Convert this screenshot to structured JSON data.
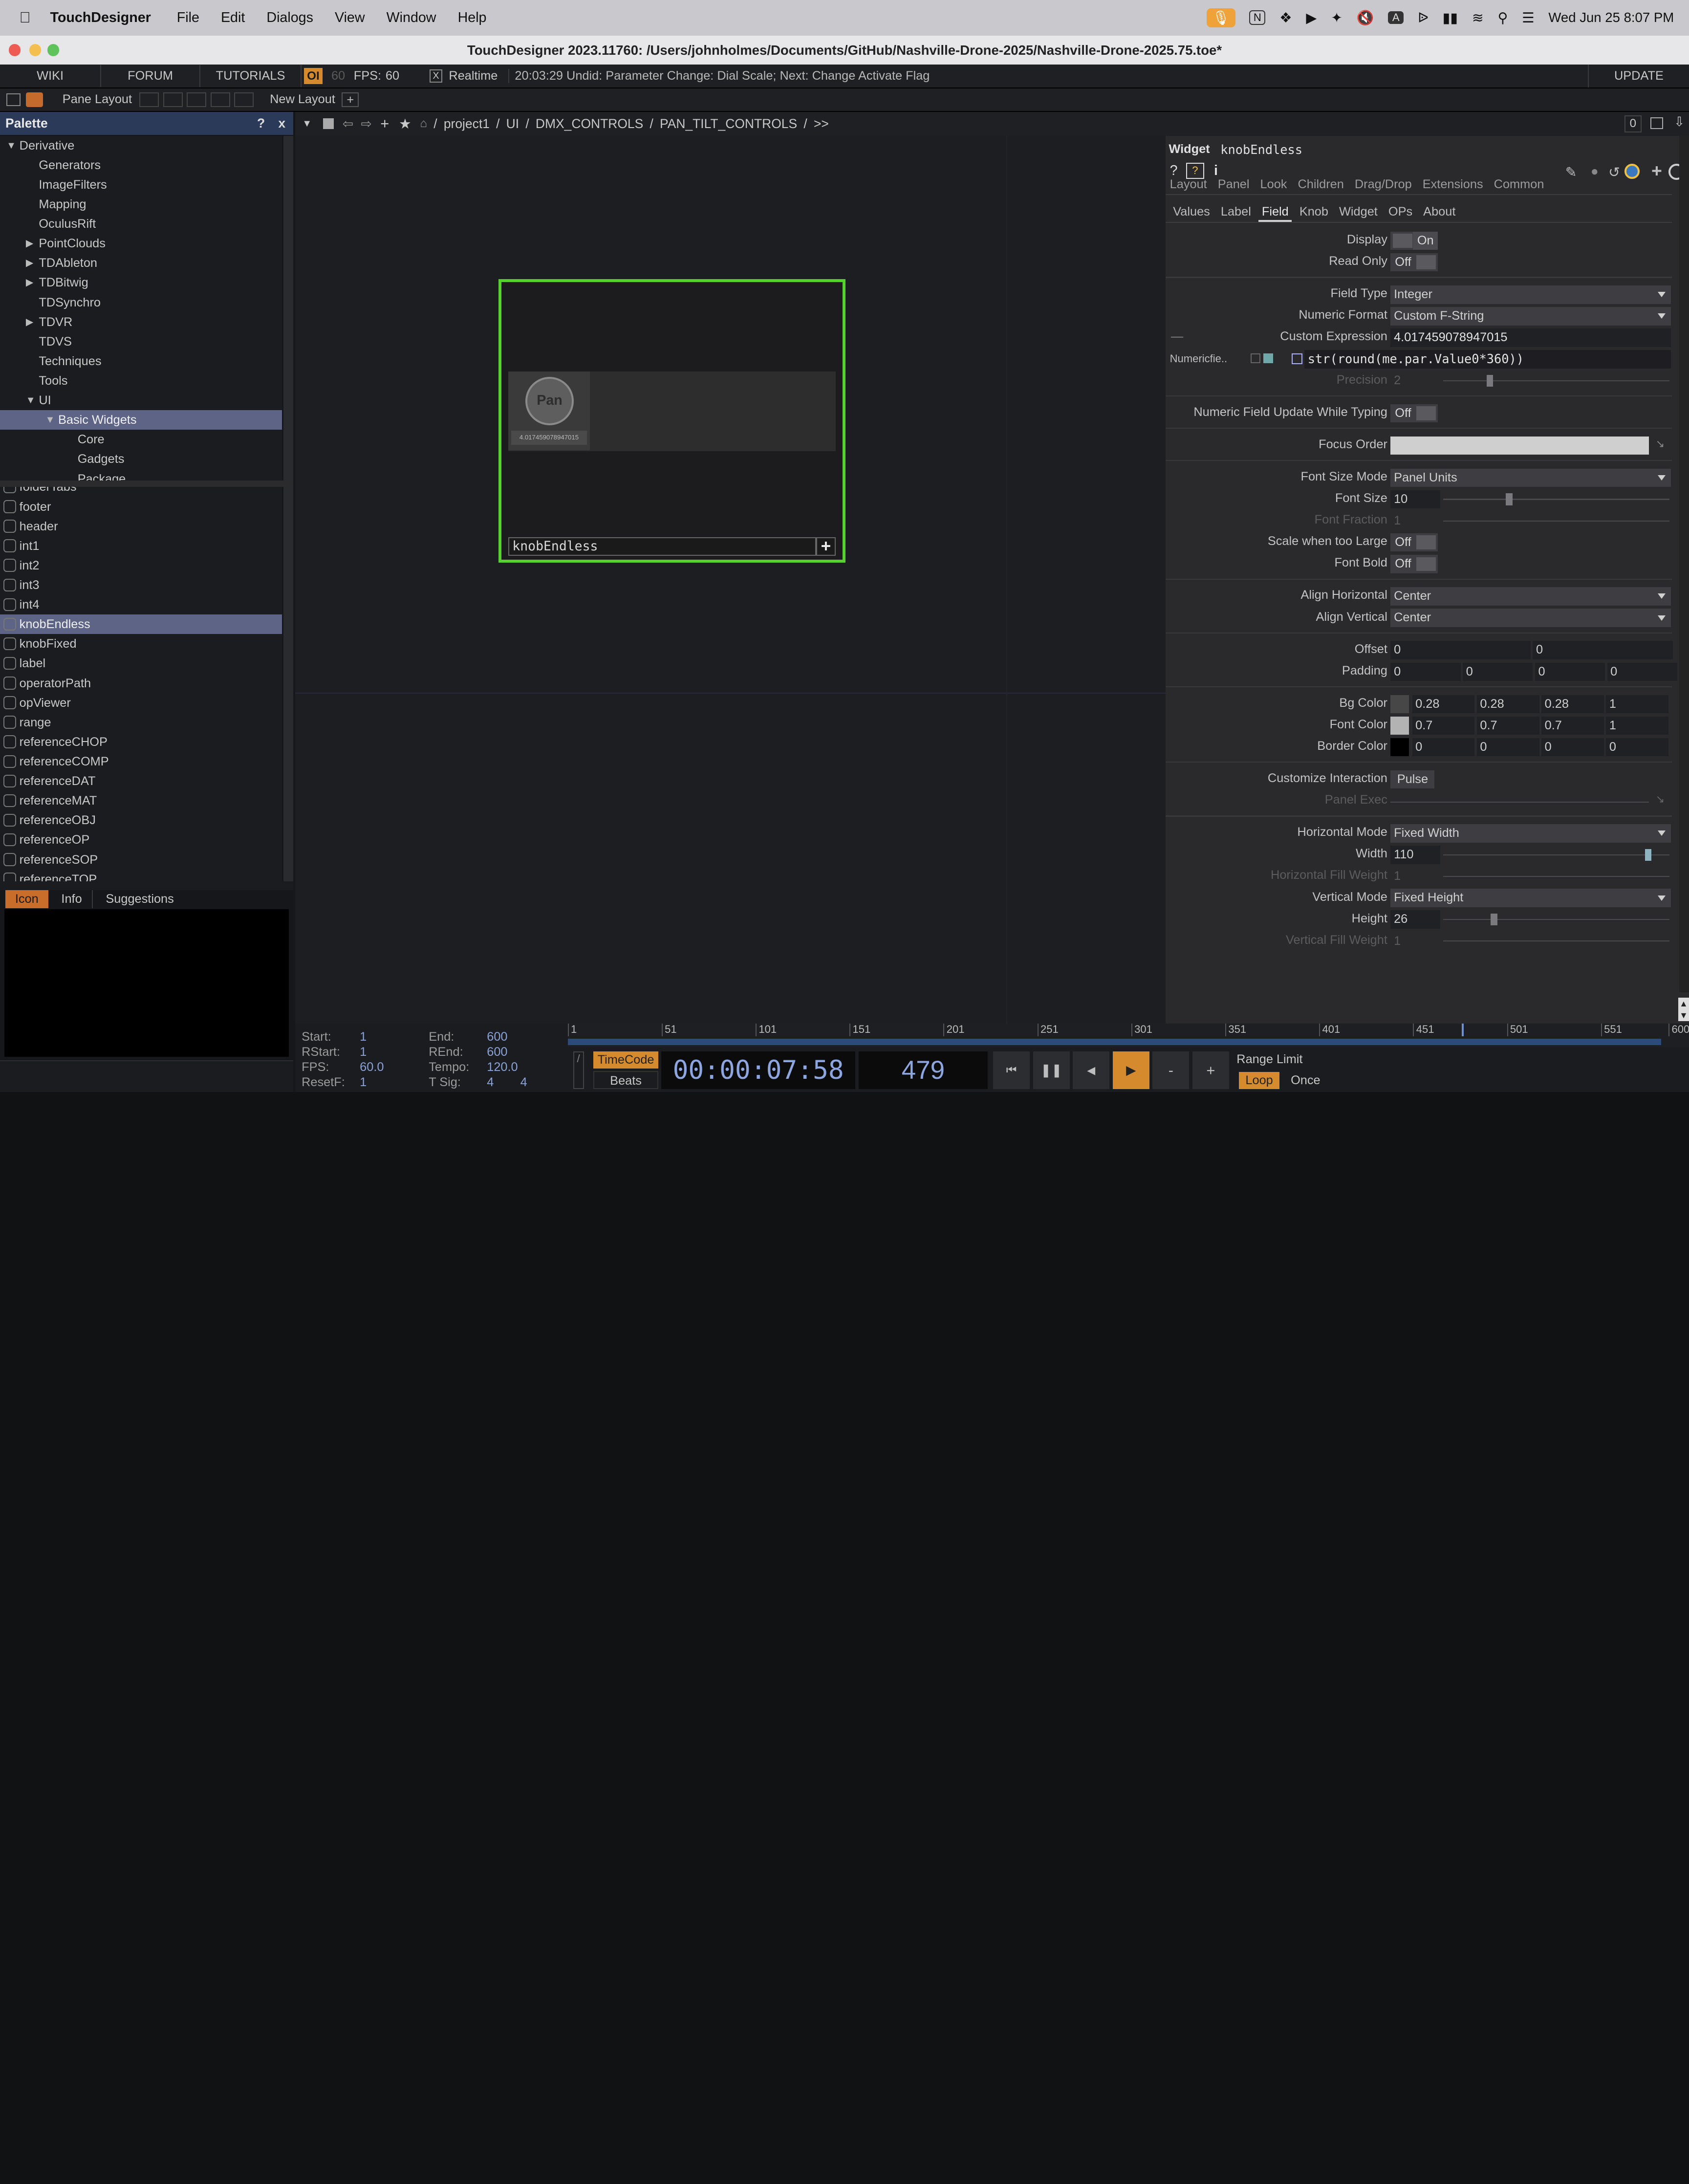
{
  "menubar": {
    "app": "TouchDesigner",
    "items": [
      "File",
      "Edit",
      "Dialogs",
      "View",
      "Window",
      "Help"
    ],
    "datetime": "Wed Jun 25  8:07 PM"
  },
  "window_title": "TouchDesigner 2023.11760: /Users/johnholmes/Documents/GitHub/Nashville-Drone-2025/Nashville-Drone-2025.75.toe*",
  "toolbar": {
    "wiki": "WIKI",
    "forum": "FORUM",
    "tutorials": "TUTORIALS",
    "oi": "OI",
    "fps_dim": "60",
    "fps_label": "FPS:",
    "fps_value": "60",
    "realtime_box": "X",
    "realtime": "Realtime",
    "status": "20:03:29 Undid: Parameter Change: Dial Scale; Next: Change Activate Flag",
    "update": "UPDATE"
  },
  "toolbar2": {
    "pane_layout": "Pane Layout",
    "new_layout": "New Layout"
  },
  "palette": {
    "title": "Palette",
    "help": "?",
    "close": "x",
    "tree": [
      {
        "label": "Derivative",
        "level": 0,
        "arrow": "down"
      },
      {
        "label": "Generators",
        "level": 1,
        "arrow": ""
      },
      {
        "label": "ImageFilters",
        "level": 1,
        "arrow": ""
      },
      {
        "label": "Mapping",
        "level": 1,
        "arrow": ""
      },
      {
        "label": "OculusRift",
        "level": 1,
        "arrow": ""
      },
      {
        "label": "PointClouds",
        "level": 1,
        "arrow": "right"
      },
      {
        "label": "TDAbleton",
        "level": 1,
        "arrow": "right"
      },
      {
        "label": "TDBitwig",
        "level": 1,
        "arrow": "right"
      },
      {
        "label": "TDSynchro",
        "level": 1,
        "arrow": ""
      },
      {
        "label": "TDVR",
        "level": 1,
        "arrow": "right"
      },
      {
        "label": "TDVS",
        "level": 1,
        "arrow": ""
      },
      {
        "label": "Techniques",
        "level": 1,
        "arrow": ""
      },
      {
        "label": "Tools",
        "level": 1,
        "arrow": ""
      },
      {
        "label": "UI",
        "level": 1,
        "arrow": "down"
      },
      {
        "label": "Basic Widgets",
        "level": 2,
        "arrow": "down",
        "selected": true
      },
      {
        "label": "Core",
        "level": 3,
        "arrow": ""
      },
      {
        "label": "Gadgets",
        "level": 3,
        "arrow": ""
      },
      {
        "label": "Package",
        "level": 3,
        "arrow": ""
      }
    ],
    "items": [
      "folderTabs",
      "footer",
      "header",
      "int1",
      "int2",
      "int3",
      "int4",
      "knobEndless",
      "knobFixed",
      "label",
      "operatorPath",
      "opViewer",
      "range",
      "referenceCHOP",
      "referenceCOMP",
      "referenceDAT",
      "referenceMAT",
      "referenceOBJ",
      "referenceOP",
      "referenceSOP",
      "referenceTOP"
    ],
    "selected_item": "knobEndless",
    "tabs": [
      "Icon",
      "Info",
      "Suggestions"
    ]
  },
  "network": {
    "path": [
      "project1",
      "UI",
      "DMX_CONTROLS",
      "PAN_TILT_CONTROLS",
      ">>"
    ],
    "path_sep": "/",
    "path_root": "/",
    "index": "0",
    "node": {
      "knob_label": "Pan",
      "knob_value": "4.017459078947015",
      "name": "knobEndless",
      "plus": "+"
    }
  },
  "params": {
    "header_type": "Widget",
    "header_name": "knobEndless",
    "tabs_row1": [
      "Layout",
      "Panel",
      "Look",
      "Children",
      "Drag/Drop",
      "Extensions",
      "Common"
    ],
    "tabs_row2": [
      "Values",
      "Label",
      "Field",
      "Knob",
      "Widget",
      "OPs",
      "About"
    ],
    "active_tab": "Field",
    "display": {
      "label": "Display",
      "value": "On"
    },
    "read_only": {
      "label": "Read Only",
      "value": "Off"
    },
    "field_type": {
      "label": "Field Type",
      "value": "Integer"
    },
    "numeric_format": {
      "label": "Numeric Format",
      "value": "Custom F-String"
    },
    "custom_expression": {
      "label": "Custom Expression",
      "value": "4.017459078947015",
      "dash": "—"
    },
    "numeric_field_expr": {
      "label": "Numericfie..",
      "value": "str(round(me.par.Value0*360))"
    },
    "precision": {
      "label": "Precision",
      "value": "2"
    },
    "numeric_update": {
      "label": "Numeric Field Update While Typing",
      "value": "Off"
    },
    "focus_order": {
      "label": "Focus Order"
    },
    "font_size_mode": {
      "label": "Font Size Mode",
      "value": "Panel Units"
    },
    "font_size": {
      "label": "Font Size",
      "value": "10"
    },
    "font_fraction": {
      "label": "Font Fraction",
      "value": "1"
    },
    "scale_large": {
      "label": "Scale when too Large",
      "value": "Off"
    },
    "font_bold": {
      "label": "Font Bold",
      "value": "Off"
    },
    "align_h": {
      "label": "Align Horizontal",
      "value": "Center"
    },
    "align_v": {
      "label": "Align Vertical",
      "value": "Center"
    },
    "offset": {
      "label": "Offset",
      "values": [
        "0",
        "0"
      ]
    },
    "padding": {
      "label": "Padding",
      "values": [
        "0",
        "0",
        "0",
        "0"
      ]
    },
    "bg_color": {
      "label": "Bg Color",
      "values": [
        "0.28",
        "0.28",
        "0.28",
        "1"
      ],
      "swatch": "#474747"
    },
    "font_color": {
      "label": "Font Color",
      "values": [
        "0.7",
        "0.7",
        "0.7",
        "1"
      ],
      "swatch": "#b3b3b3"
    },
    "border_color": {
      "label": "Border Color",
      "values": [
        "0",
        "0",
        "0",
        "0"
      ],
      "swatch": "#000000"
    },
    "customize_interaction": {
      "label": "Customize Interaction",
      "value": "Pulse"
    },
    "panel_exec": {
      "label": "Panel Exec"
    },
    "horizontal_mode": {
      "label": "Horizontal Mode",
      "value": "Fixed Width"
    },
    "width": {
      "label": "Width",
      "value": "110"
    },
    "h_fill_weight": {
      "label": "Horizontal Fill Weight",
      "value": "1"
    },
    "vertical_mode": {
      "label": "Vertical Mode",
      "value": "Fixed Height"
    },
    "height": {
      "label": "Height",
      "value": "26"
    },
    "v_fill_weight": {
      "label": "Vertical Fill Weight",
      "value": "1"
    }
  },
  "timeline": {
    "start_label": "Start:",
    "start": "1",
    "end_label": "End:",
    "end": "600",
    "rstart_label": "RStart:",
    "rstart": "1",
    "rend_label": "REnd:",
    "rend": "600",
    "fps_label": "FPS:",
    "fps": "60.0",
    "tempo_label": "Tempo:",
    "tempo": "120.0",
    "resetf_label": "ResetF:",
    "resetf": "1",
    "tsig_label": "T Sig:",
    "tsig_a": "4",
    "tsig_b": "4",
    "ticks": [
      "1",
      "51",
      "101",
      "151",
      "201",
      "251",
      "301",
      "351",
      "401",
      "451",
      "501",
      "551",
      "600"
    ],
    "timecode_btn": "TimeCode",
    "beats_btn": "Beats",
    "timecode": "00:00:07:58",
    "frame": "479",
    "range_limit": "Range Limit",
    "loop": "Loop",
    "once": "Once",
    "minus": "-",
    "plus": "+"
  }
}
